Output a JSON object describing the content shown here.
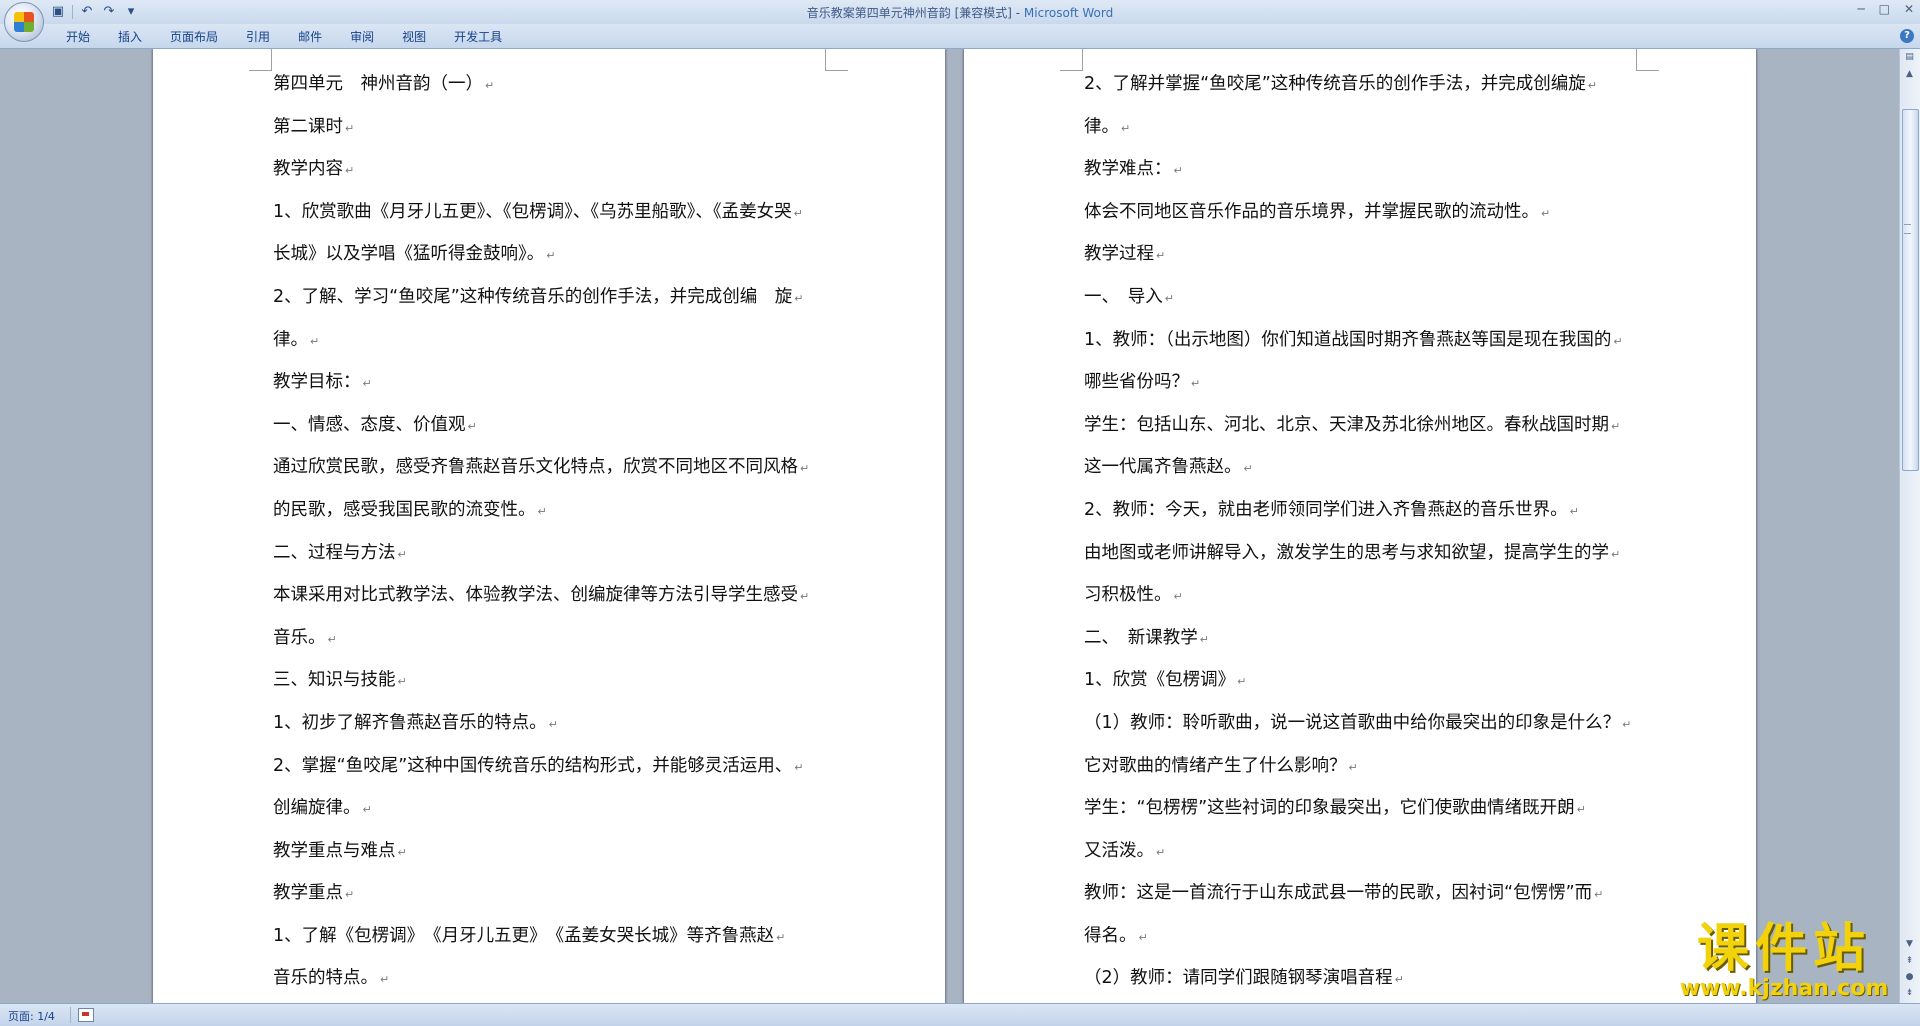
{
  "window": {
    "title": "音乐教案第四单元神州音韵 [兼容模式] - ",
    "app_name": "Microsoft Word",
    "controls": [
      "─",
      "□",
      "✕"
    ]
  },
  "quick_access": {
    "icons": [
      "save-icon",
      "undo-icon",
      "redo-icon",
      "customize-icon"
    ],
    "glyphs": [
      "▣",
      "↶",
      "↷",
      "▾"
    ]
  },
  "ribbon": {
    "tabs": [
      "开始",
      "插入",
      "页面布局",
      "引用",
      "邮件",
      "审阅",
      "视图",
      "开发工具"
    ],
    "help": "?"
  },
  "document": {
    "left_page": [
      "第四单元　神州音韵（一）",
      "第二课时",
      "教学内容",
      "1、欣赏歌曲《月牙儿五更》、《包楞调》、《乌苏里船歌》、《孟姜女哭",
      "长城》以及学唱《猛听得金鼓响》。",
      "2、了解、学习“鱼咬尾”这种传统音乐的创作手法，并完成创编　旋",
      "律。",
      "教学目标：",
      "一、情感、态度、价值观",
      "通过欣赏民歌，感受齐鲁燕赵音乐文化特点，欣赏不同地区不同风格",
      "的民歌，感受我国民歌的流变性。",
      "二、过程与方法",
      "本课采用对比式教学法、体验教学法、创编旋律等方法引导学生感受",
      "音乐。",
      "三、知识与技能",
      "1、初步了解齐鲁燕赵音乐的特点。",
      "2、掌握“鱼咬尾”这种中国传统音乐的结构形式，并能够灵活运用、",
      "创编旋律。",
      "教学重点与难点",
      "教学重点",
      "1、了解《包楞调》　《月牙儿五更》　《孟姜女哭长城》等齐鲁燕赵",
      "音乐的特点。"
    ],
    "right_page": [
      "2、了解并掌握“鱼咬尾”这种传统音乐的创作手法，并完成创编旋",
      "律。",
      "教学难点：",
      "体会不同地区音乐作品的音乐境界，并掌握民歌的流动性。",
      "教学过程",
      "一、　导入",
      "1、教师：（出示地图）你们知道战国时期齐鲁燕赵等国是现在我国的",
      "哪些省份吗？",
      "学生：包括山东、河北、北京、天津及苏北徐州地区。春秋战国时期",
      "这一代属齐鲁燕赵。",
      "2、教师：今天，就由老师领同学们进入齐鲁燕赵的音乐世界。",
      "由地图或老师讲解导入，激发学生的思考与求知欲望，提高学生的学",
      "习积极性。",
      "二、　新课教学",
      "1、欣赏《包楞调》",
      "（1）教师：聆听歌曲，说一说这首歌曲中给你最突出的印象是什么？",
      "它对歌曲的情绪产生了什么影响？",
      "学生：“包楞楞”这些衬词的印象最突出，它们使歌曲情绪既开朗",
      "又活泼。",
      "教师：这是一首流行于山东成武县一带的民歌，因衬词“包愣愣”而",
      "得名。",
      "（2）教师：请同学们跟随钢琴演唱音程"
    ]
  },
  "statusbar": {
    "page_info": "页面: 1/4"
  },
  "watermark": {
    "title": "课件站",
    "url": "www.kjzhan.com"
  }
}
